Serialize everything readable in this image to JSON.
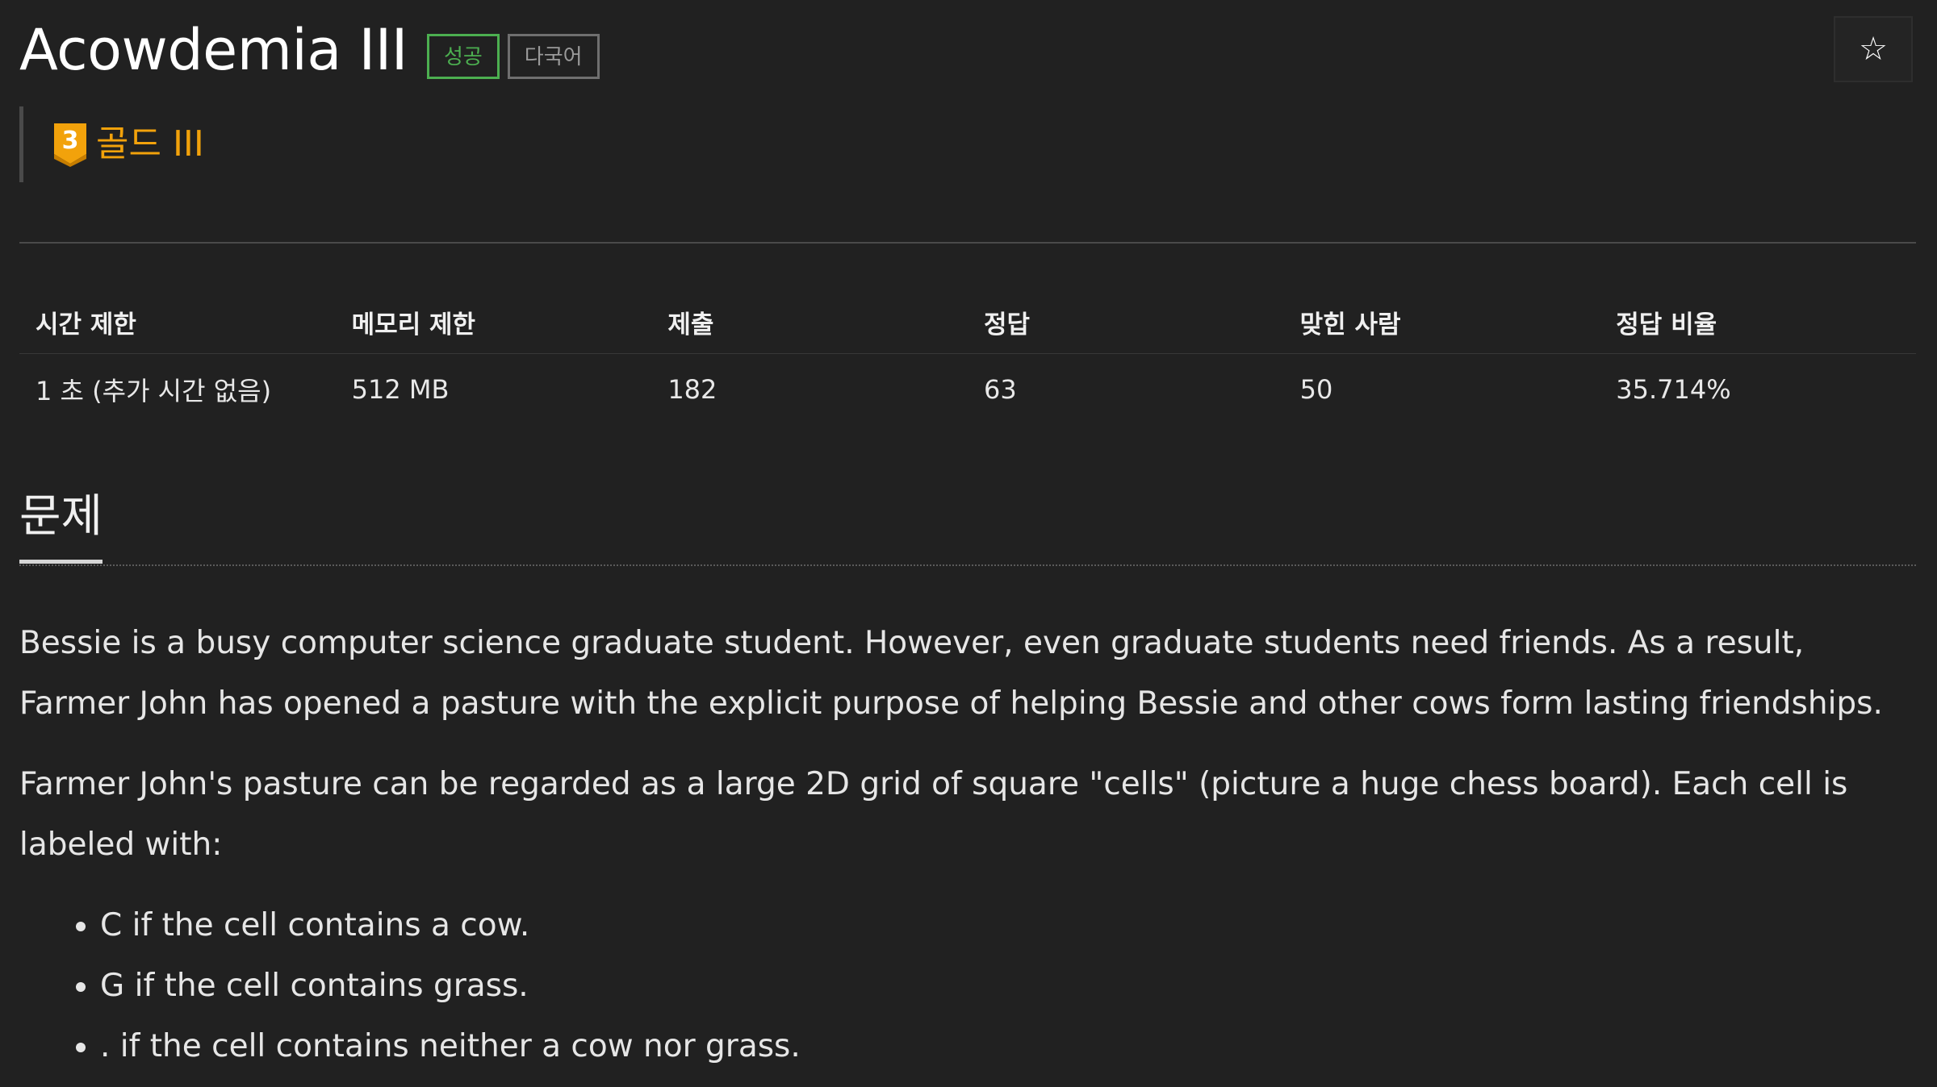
{
  "header": {
    "title": "Acowdemia III",
    "tags": {
      "success": "성공",
      "multilang": "다국어"
    },
    "star_icon": "☆"
  },
  "tier": {
    "level": "3",
    "label": "골드 III",
    "color": "#f2a20b",
    "icon": "gold-tier-badge-icon"
  },
  "info_table": {
    "headers": [
      "시간 제한",
      "메모리 제한",
      "제출",
      "정답",
      "맞힌 사람",
      "정답 비율"
    ],
    "values": [
      "1 초 (추가 시간 없음)",
      "512 MB",
      "182",
      "63",
      "50",
      "35.714%"
    ]
  },
  "section": {
    "title": "문제"
  },
  "problem": {
    "paragraphs": [
      "Bessie is a busy computer science graduate student. However, even graduate students need friends. As a result, Farmer John has opened a pasture with the explicit purpose of helping Bessie and other cows form lasting friendships.",
      "Farmer John's pasture can be regarded as a large 2D grid of square \"cells\" (picture a huge chess board). Each cell is labeled with:"
    ],
    "list": [
      "C if the cell contains a cow.",
      "G if the cell contains grass.",
      ". if the cell contains neither a cow nor grass."
    ]
  }
}
